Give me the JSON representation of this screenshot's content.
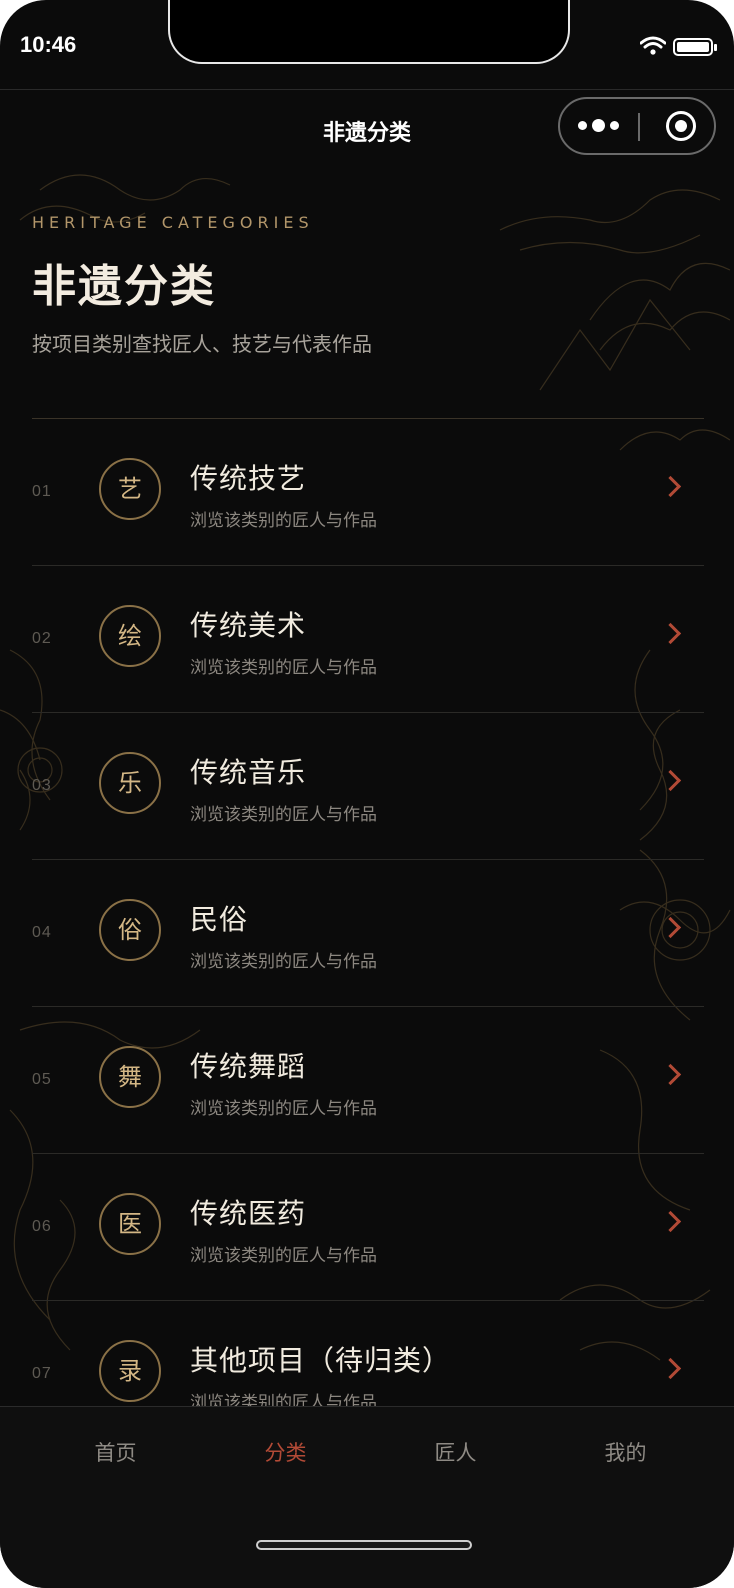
{
  "status": {
    "time": "10:46",
    "battery_level": 1.0
  },
  "nav": {
    "title": "非遗分类"
  },
  "capsule": {
    "more_icon": "more-dots-icon",
    "close_icon": "target-icon"
  },
  "header": {
    "eyebrow": "HERITAGE CATEGORIES",
    "title": "非遗分类",
    "subtitle": "按项目类别查找匠人、技艺与代表作品"
  },
  "categories": [
    {
      "index": "01",
      "glyph": "艺",
      "title": "传统技艺",
      "subtitle": "浏览该类别的匠人与作品"
    },
    {
      "index": "02",
      "glyph": "绘",
      "title": "传统美术",
      "subtitle": "浏览该类别的匠人与作品"
    },
    {
      "index": "03",
      "glyph": "乐",
      "title": "传统音乐",
      "subtitle": "浏览该类别的匠人与作品"
    },
    {
      "index": "04",
      "glyph": "俗",
      "title": "民俗",
      "subtitle": "浏览该类别的匠人与作品"
    },
    {
      "index": "05",
      "glyph": "舞",
      "title": "传统舞蹈",
      "subtitle": "浏览该类别的匠人与作品"
    },
    {
      "index": "06",
      "glyph": "医",
      "title": "传统医药",
      "subtitle": "浏览该类别的匠人与作品"
    },
    {
      "index": "07",
      "glyph": "录",
      "title": "其他项目（待归类）",
      "subtitle": "浏览该类别的匠人与作品"
    }
  ],
  "tabs": [
    {
      "label": "首页",
      "active": false
    },
    {
      "label": "分类",
      "active": true
    },
    {
      "label": "匠人",
      "active": false
    },
    {
      "label": "我的",
      "active": false
    }
  ],
  "colors": {
    "accent": "#b24a36",
    "gold": "#b2966a",
    "background": "#0b0b0b"
  }
}
